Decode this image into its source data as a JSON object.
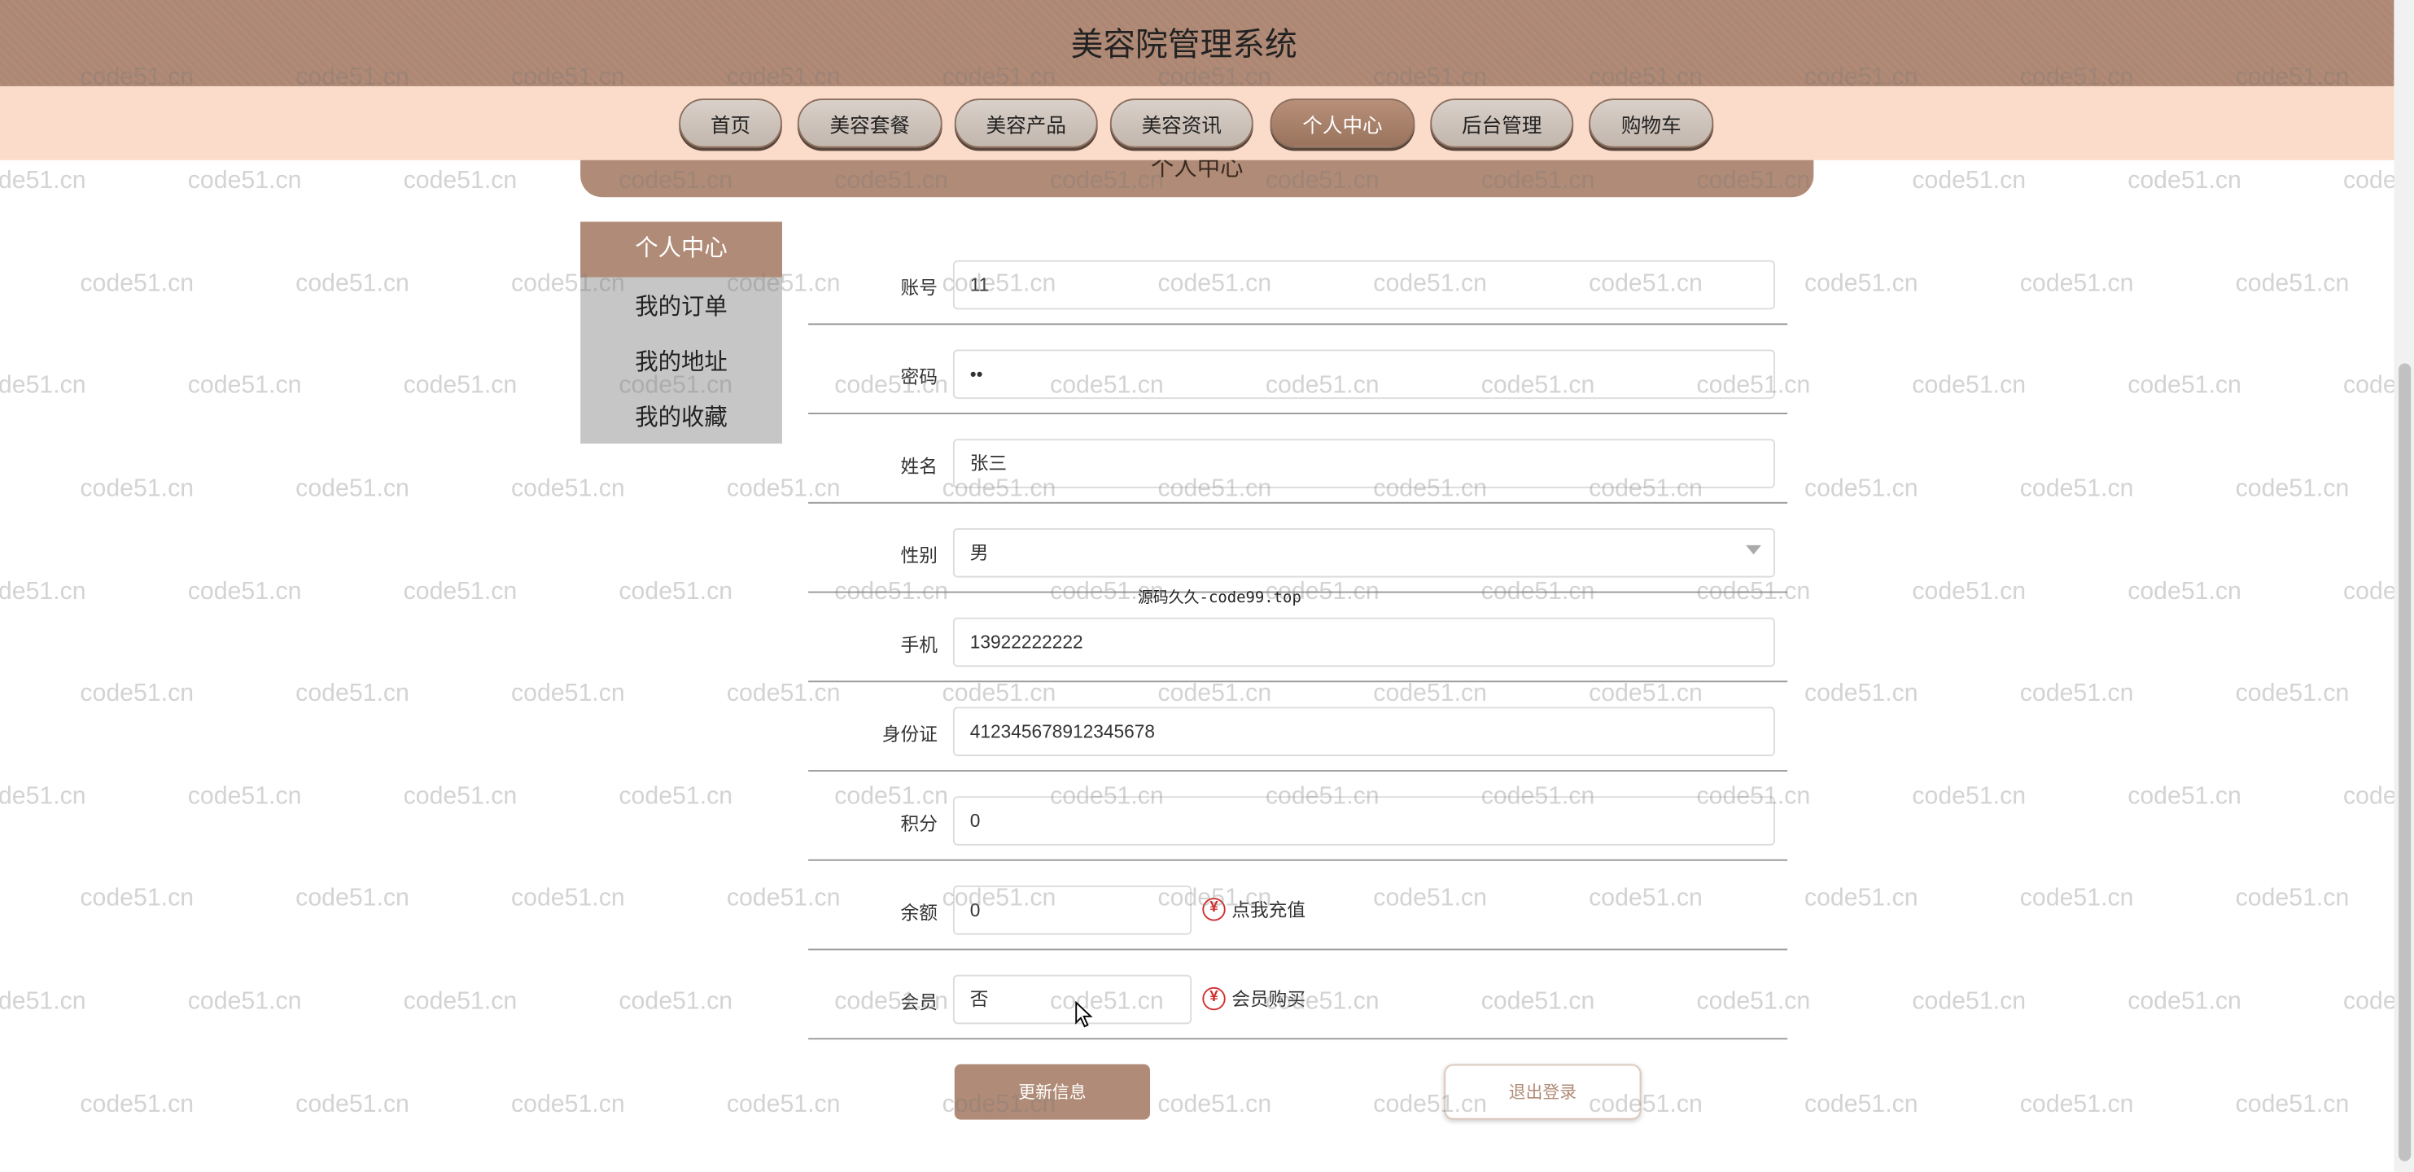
{
  "site": {
    "title": "美容院管理系统"
  },
  "nav": {
    "items": [
      {
        "label": "首页"
      },
      {
        "label": "美容套餐"
      },
      {
        "label": "美容产品"
      },
      {
        "label": "美容资讯"
      },
      {
        "label": "个人中心",
        "active": true
      },
      {
        "label": "后台管理"
      },
      {
        "label": "购物车"
      }
    ]
  },
  "page": {
    "banner_title": "个人中心"
  },
  "sidebar": {
    "heading": "个人中心",
    "items": [
      {
        "label": "我的订单"
      },
      {
        "label": "我的地址"
      },
      {
        "label": "我的收藏"
      }
    ]
  },
  "form": {
    "account": {
      "label": "账号",
      "value": "11"
    },
    "password": {
      "label": "密码",
      "value": "••"
    },
    "name": {
      "label": "姓名",
      "value": "张三"
    },
    "gender": {
      "label": "性别",
      "value": "男"
    },
    "phone": {
      "label": "手机",
      "value": "13922222222"
    },
    "id_card": {
      "label": "身份证",
      "value": "412345678912345678"
    },
    "points": {
      "label": "积分",
      "value": "0"
    },
    "balance": {
      "label": "余额",
      "value": "0",
      "action": "点我充值",
      "action_icon": "yen-icon"
    },
    "member": {
      "label": "会员",
      "value": "否",
      "action": "会员购买",
      "action_icon": "yen-icon"
    }
  },
  "buttons": {
    "update": "更新信息",
    "logout": "退出登录"
  },
  "source_note": "源码久久-code99.top",
  "watermark_text": "code51.cn",
  "colors": {
    "header": "#b08b77",
    "nav_bg": "#fbdccb",
    "accent": "#b08b77",
    "sidebar_bg": "#c6c6c6"
  }
}
